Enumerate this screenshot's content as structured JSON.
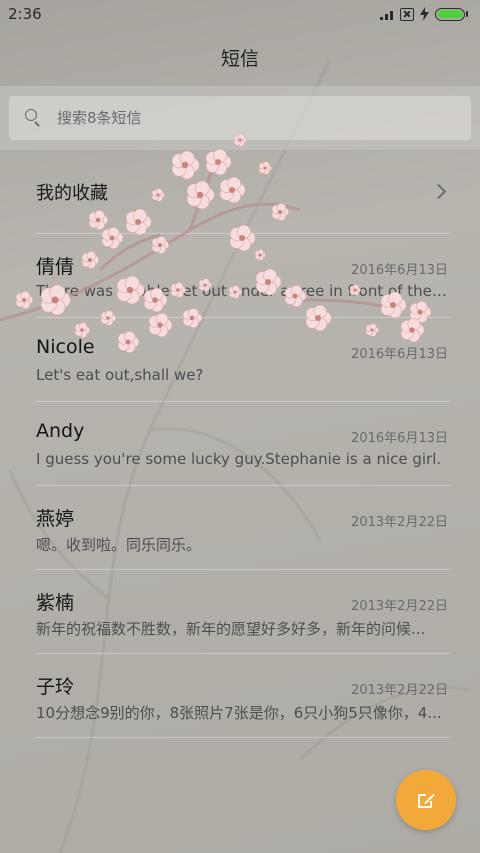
{
  "status_bar": {
    "time": "2:36",
    "battery_level": 1.0
  },
  "header": {
    "title": "短信"
  },
  "search": {
    "placeholder": "搜索8条短信"
  },
  "favorites": {
    "label": "我的收藏"
  },
  "conversations": [
    {
      "name": "倩倩",
      "date": "2016年6月13日",
      "preview": "There was a table set out under a tree in front of the ho..."
    },
    {
      "name": "Nicole",
      "date": "2016年6月13日",
      "preview": "Let's eat out,shall we?"
    },
    {
      "name": "Andy",
      "date": "2016年6月13日",
      "preview": "I guess you're some lucky guy.Stephanie is a nice girl."
    },
    {
      "name": "燕婷",
      "date": "2013年2月22日",
      "preview": "嗯。收到啦。同乐同乐。"
    },
    {
      "name": "紫楠",
      "date": "2013年2月22日",
      "preview": "新年的祝福数不胜数，新年的愿望好多好多，新年的问候..."
    },
    {
      "name": "子玲",
      "date": "2013年2月22日",
      "preview": "10分想念9别的你，8张照片7张是你，6只小狗5只像你，4..."
    }
  ],
  "colors": {
    "accent": "#f2a93a",
    "battery": "#4cd13a",
    "blossom": "#f6dcdc"
  },
  "icons": {
    "search": "search-icon",
    "chevron": "chevron-right-icon",
    "compose": "compose-icon"
  }
}
